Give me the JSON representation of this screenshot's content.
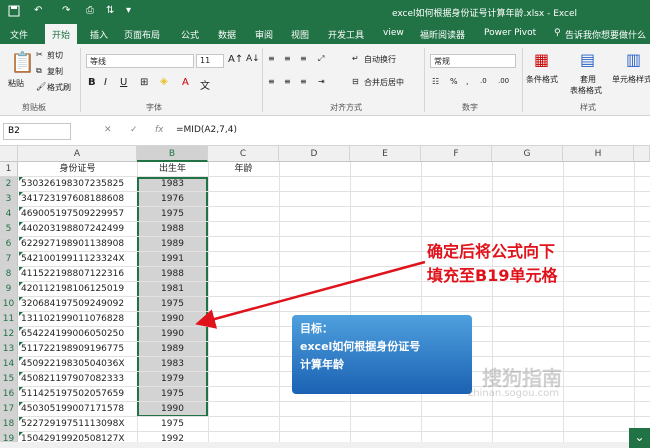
{
  "window": {
    "title": "excel如何根据身份证号计算年龄.xlsx - Excel"
  },
  "colors": {
    "brand": "#217346",
    "annotation": "#e0121b",
    "callout": "#2a7bcc"
  },
  "tabs": [
    "文件",
    "开始",
    "插入",
    "页面布局",
    "公式",
    "数据",
    "审阅",
    "视图",
    "开发工具",
    "view",
    "福昕阅读器",
    "Power Pivot"
  ],
  "tell_me": "告诉我你想要做什么",
  "ribbon": {
    "paste": "粘贴",
    "cut": "剪切",
    "copy": "复制",
    "format_painter": "格式刷",
    "clipboard": "剪贴板",
    "font_name": "等线",
    "font_size": "11",
    "font_group": "字体",
    "wen": "文",
    "wrap_text": "自动换行",
    "merge_center": "合并后居中",
    "alignment_group": "对齐方式",
    "number_format": "常规",
    "number_group": "数字",
    "cond_format": "条件格式",
    "table_format_1": "套用",
    "table_format_2": "表格格式",
    "cell_styles": "单元格样式",
    "styles_group": "样式",
    "bold": "B",
    "italic": "I",
    "underline": "U"
  },
  "formula_bar": {
    "name_box": "B2",
    "fx": "fx",
    "formula": "=MID(A2,7,4)"
  },
  "columns": [
    "A",
    "B",
    "C",
    "D",
    "E",
    "F",
    "G",
    "H"
  ],
  "header_row": {
    "A": "身份证号",
    "B": "出生年",
    "C": "年龄"
  },
  "rows": [
    {
      "id": "530326198307235825",
      "year": "1983"
    },
    {
      "id": "341723197608188608",
      "year": "1976"
    },
    {
      "id": "469005197509229957",
      "year": "1975"
    },
    {
      "id": "440203198807242499",
      "year": "1988"
    },
    {
      "id": "622927198901138908",
      "year": "1989"
    },
    {
      "id": "54210019911123324X",
      "year": "1991"
    },
    {
      "id": "411522198807122316",
      "year": "1988"
    },
    {
      "id": "420112198106125019",
      "year": "1981"
    },
    {
      "id": "320684197509249092",
      "year": "1975"
    },
    {
      "id": "131102199011076828",
      "year": "1990"
    },
    {
      "id": "654224199006050250",
      "year": "1990"
    },
    {
      "id": "511722198909196775",
      "year": "1989"
    },
    {
      "id": "45092219830504036X",
      "year": "1983"
    },
    {
      "id": "450821197907082333",
      "year": "1979"
    },
    {
      "id": "511425197502057659",
      "year": "1975"
    },
    {
      "id": "450305199007171578",
      "year": "1990"
    },
    {
      "id": "52272919751113098X",
      "year": "1975"
    },
    {
      "id": "15042919920508127X",
      "year": "1992"
    }
  ],
  "row_numbers": [
    "1",
    "2",
    "3",
    "4",
    "5",
    "6",
    "7",
    "8",
    "9",
    "10",
    "11",
    "12",
    "13",
    "14",
    "15",
    "16",
    "17",
    "18",
    "19",
    "20"
  ],
  "annotation": {
    "line1": "确定后将公式向下",
    "line2": "填充至B19单元格"
  },
  "callout": {
    "line1": "目标：",
    "line2": "excel如何根据身份证号",
    "line3": "计算年龄"
  },
  "watermark": {
    "line1": "搜狗指南",
    "line2": "zhinan.sogou.com"
  }
}
